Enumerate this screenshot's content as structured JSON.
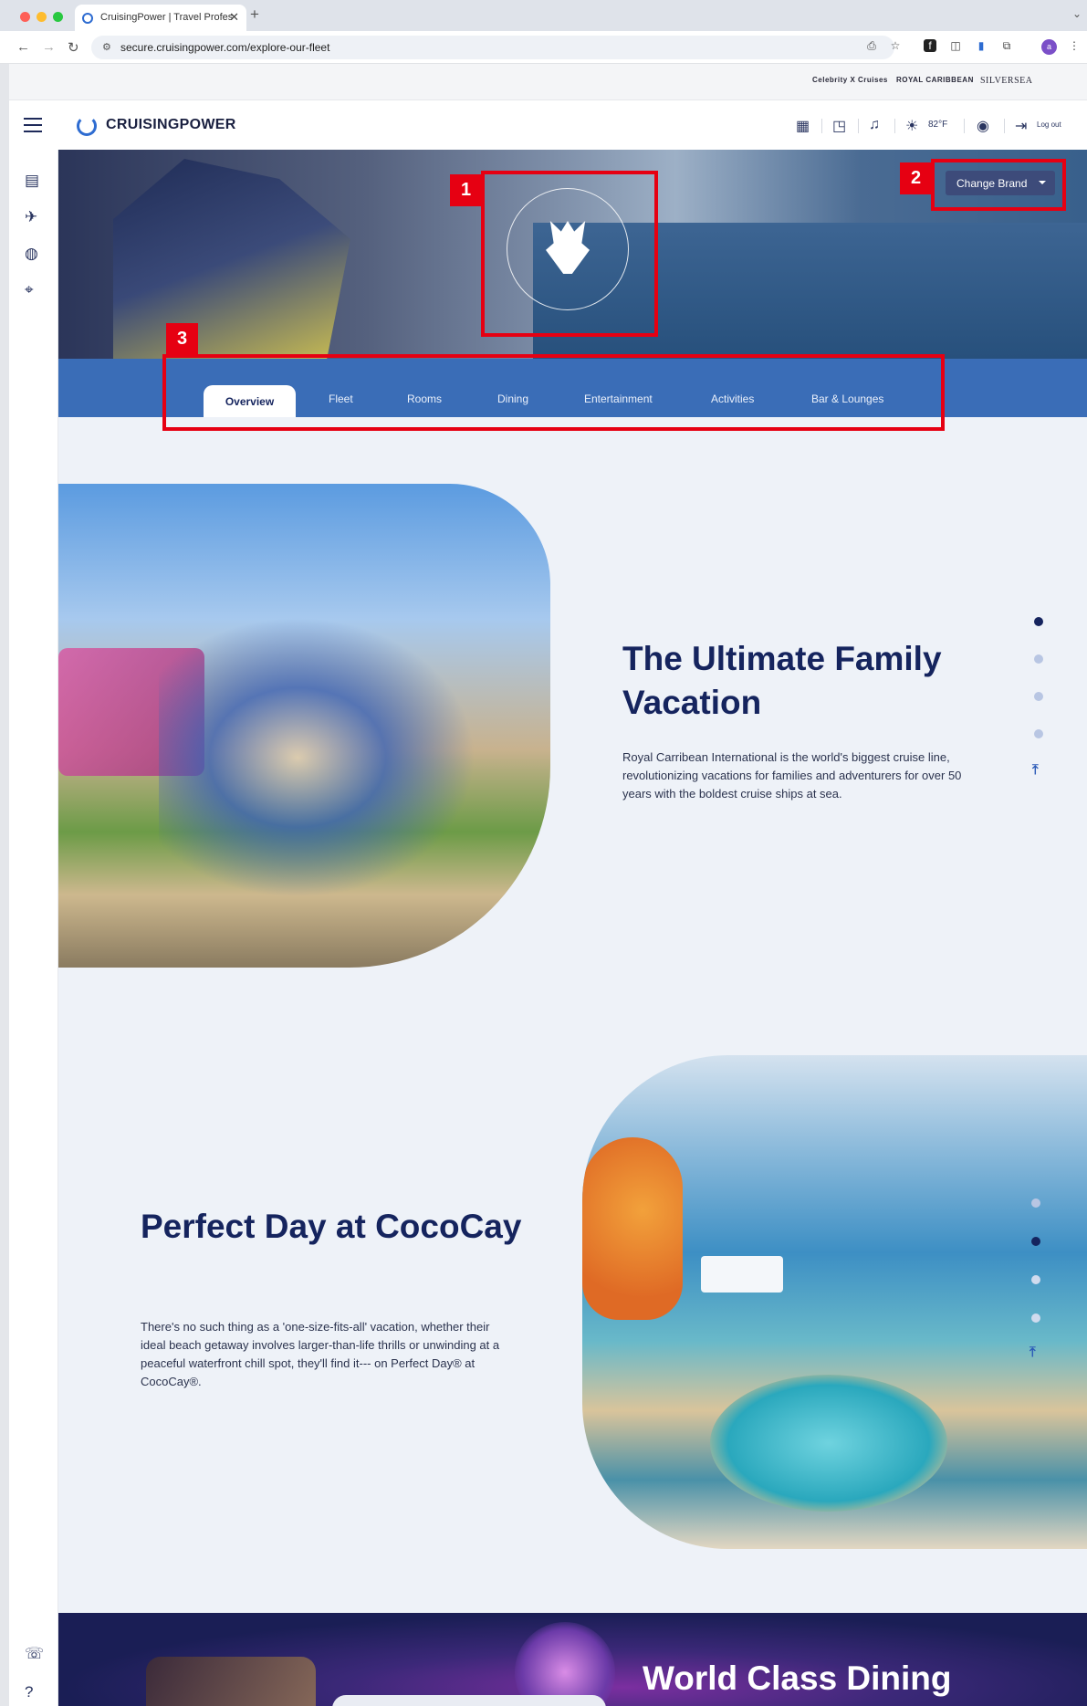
{
  "browser": {
    "tab_title": "CruisingPower | Travel Profes",
    "url": "secure.cruisingpower.com/explore-our-fleet",
    "profile_initial": "a"
  },
  "brand_strip": {
    "brands": [
      "Celebrity X Cruises",
      "ROYAL CARIBBEAN",
      "SILVERSEA"
    ]
  },
  "header": {
    "logo_text": "CRUISINGPOWER",
    "temperature": "82°F",
    "logout_label": "Log out"
  },
  "hero": {
    "change_brand_label": "Change Brand"
  },
  "tabs": {
    "active": "Overview",
    "items": [
      "Fleet",
      "Rooms",
      "Dining",
      "Entertainment",
      "Activities",
      "Bar & Lounges"
    ]
  },
  "sections": [
    {
      "title": "The Ultimate Family Vacation",
      "body": "Royal Carribean International is the world's biggest cruise line, revolutionizing vacations for families and adventurers for over 50 years with the boldest cruise ships at sea."
    },
    {
      "title": "Perfect Day at CocoCay",
      "body": "There's no such thing as a 'one-size-fits-all' vacation, whether their ideal beach getaway involves larger-than-life thrills or unwinding at a peaceful waterfront chill spot, they'll find it--- on Perfect Day® at CocoCay®."
    }
  ],
  "banner": {
    "title": "World Class Dining"
  },
  "annotations": [
    "1",
    "2",
    "3"
  ],
  "colors": {
    "navy": "#15245e",
    "tab_strip": "#3a6db7",
    "annotation_red": "#e60012",
    "change_brand_bg": "#3d4b7a"
  }
}
